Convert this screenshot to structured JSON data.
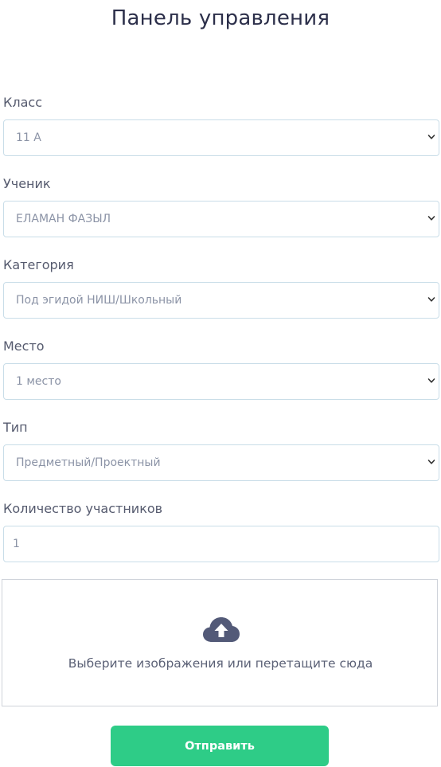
{
  "header": {
    "title": "Панель управления"
  },
  "form": {
    "class": {
      "label": "Класс",
      "value": "11 А"
    },
    "student": {
      "label": "Ученик",
      "value": "ЕЛАМАН ФАЗЫЛ"
    },
    "category": {
      "label": "Категория",
      "value": "Под эгидой НИШ/Школьный"
    },
    "place": {
      "label": "Место",
      "value": "1 место"
    },
    "type": {
      "label": "Тип",
      "value": "Предметный/Проектный"
    },
    "participants": {
      "label": "Количество участников",
      "value": "1"
    }
  },
  "upload": {
    "icon": "cloud-upload-icon",
    "text": "Выберите изображения или перетащите сюда"
  },
  "submit": {
    "label": "Отправить"
  },
  "colors": {
    "accent": "#2ecc87",
    "title": "#2c2f4a",
    "border": "#c9dde8",
    "icon": "#535a78"
  }
}
